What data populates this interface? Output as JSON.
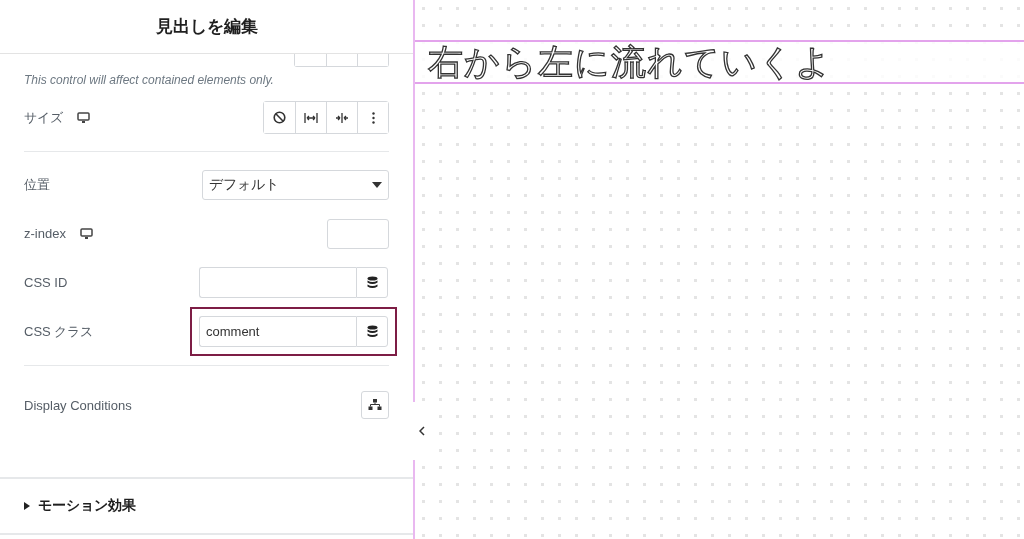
{
  "panel": {
    "title": "見出しを編集",
    "hint": "This control will affect contained elements only.",
    "rows": [
      {
        "kind": "buttons",
        "label": "サイズ",
        "responsive": true
      },
      {
        "kind": "select",
        "label": "位置",
        "value": "デフォルト",
        "divider_before": true
      },
      {
        "kind": "number",
        "label": "z-index",
        "responsive": true
      },
      {
        "kind": "dynamic",
        "label": "CSS ID",
        "highlighted": false
      },
      {
        "kind": "dynamic",
        "label": "CSS クラス",
        "value": "comment",
        "highlighted": true
      },
      {
        "kind": "conditions",
        "label": "Display Conditions",
        "divider_before": true
      }
    ],
    "section": {
      "title": "モーション効果",
      "expanded": false
    }
  },
  "canvas": {
    "heading": "右から左に流れていくよ"
  }
}
